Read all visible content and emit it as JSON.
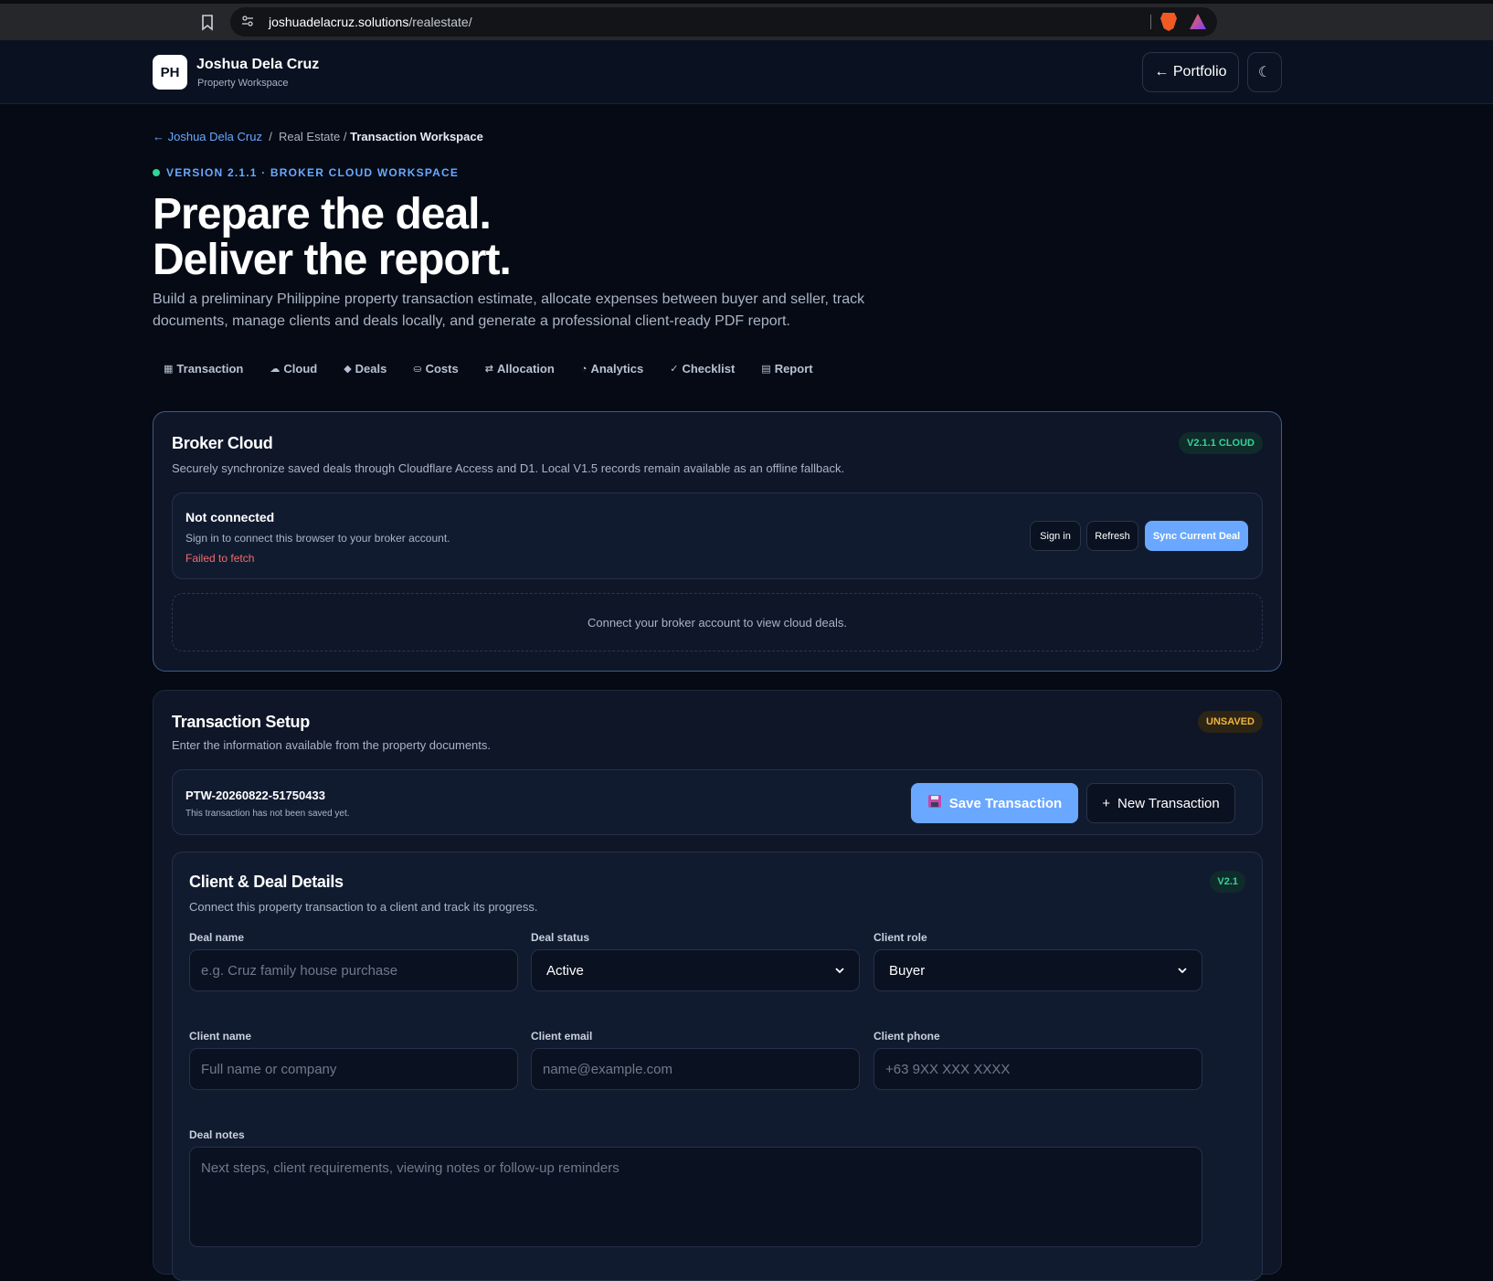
{
  "browser": {
    "url_host": "joshuadelacruz.solutions",
    "url_path": "/realestate/"
  },
  "header": {
    "logo": "PH",
    "name": "Joshua Dela Cruz",
    "subtitle": "Property Workspace",
    "portfolio_label": "← Portfolio",
    "theme_icon": "☾"
  },
  "breadcrumb": {
    "home": "← Joshua Dela Cruz",
    "sep": "/",
    "section": "Real Estate /",
    "current": "Transaction Workspace"
  },
  "version": "VERSION 2.1.1 · BROKER CLOUD WORKSPACE",
  "hero": {
    "line1": "Prepare the deal.",
    "line2": "Deliver the report.",
    "description": "Build a preliminary Philippine property transaction estimate, allocate expenses between buyer and seller, track documents, manage clients and deals locally, and generate a professional client-ready PDF report."
  },
  "tabs": [
    {
      "icon": "▦",
      "label": "Transaction"
    },
    {
      "icon": "☁",
      "label": "Cloud"
    },
    {
      "icon": "◆",
      "label": "Deals"
    },
    {
      "icon": "⛀",
      "label": "Costs"
    },
    {
      "icon": "⇄",
      "label": "Allocation"
    },
    {
      "icon": "◔",
      "label": "Analytics"
    },
    {
      "icon": "✓",
      "label": "Checklist"
    },
    {
      "icon": "▤",
      "label": "Report"
    }
  ],
  "cloud": {
    "title": "Broker Cloud",
    "badge": "V2.1.1 CLOUD",
    "description": "Securely synchronize saved deals through Cloudflare Access and D1. Local V1.5 records remain available as an offline fallback.",
    "status_title": "Not connected",
    "status_sub": "Sign in to connect this browser to your broker account.",
    "status_error": "Failed to fetch",
    "signin_label": "Sign in",
    "refresh_label": "Refresh",
    "sync_label": "Sync Current Deal",
    "empty": "Connect your broker account to view cloud deals."
  },
  "setup": {
    "title": "Transaction Setup",
    "badge": "UNSAVED",
    "description": "Enter the information available from the property documents.",
    "tx_id": "PTW-20260822-51750433",
    "tx_note": "This transaction has not been saved yet.",
    "save_label": "Save Transaction",
    "new_label": "New Transaction"
  },
  "client": {
    "title": "Client & Deal Details",
    "badge": "V2.1",
    "description": "Connect this property transaction to a client and track its progress.",
    "deal_name_label": "Deal name",
    "deal_name_placeholder": "e.g. Cruz family house purchase",
    "deal_status_label": "Deal status",
    "deal_status_value": "Active",
    "client_role_label": "Client role",
    "client_role_value": "Buyer",
    "client_name_label": "Client name",
    "client_name_placeholder": "Full name or company",
    "client_email_label": "Client email",
    "client_email_placeholder": "name@example.com",
    "client_phone_label": "Client phone",
    "client_phone_placeholder": "+63 9XX XXX XXXX",
    "deal_notes_label": "Deal notes",
    "deal_notes_placeholder": "Next steps, client requirements, viewing notes or follow-up reminders"
  },
  "colors": {
    "accent": "#6aa8ff",
    "success": "#34d399",
    "warning": "#f4b43e",
    "error": "#f26b6b",
    "background": "#050a14"
  }
}
